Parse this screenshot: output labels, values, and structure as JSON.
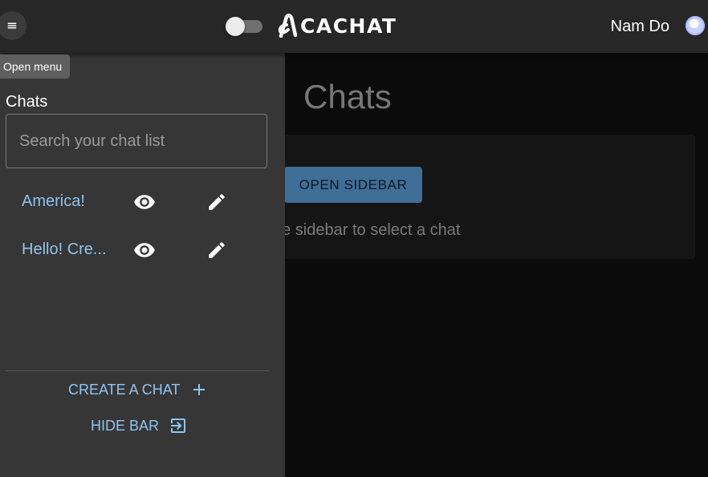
{
  "header": {
    "menu_icon": "hamburger-menu-icon",
    "tooltip": "Open menu",
    "theme_toggle_icon": "toggle-switch",
    "brand": "CACHAT",
    "user_name": "Nam Do",
    "avatar_icon": "user-avatar"
  },
  "sidebar": {
    "title": "Chats",
    "search_placeholder": "Search your chat list",
    "chats": [
      {
        "name": "America!",
        "view_icon": "eye-icon",
        "edit_icon": "pencil-icon"
      },
      {
        "name": "Hello! Cre...",
        "view_icon": "eye-icon",
        "edit_icon": "pencil-icon"
      }
    ],
    "create_label": "CREATE A CHAT",
    "create_icon": "plus-icon",
    "hide_label": "HIDE BAR",
    "hide_icon": "exit-to-app-icon"
  },
  "main": {
    "title": "Chats",
    "open_sidebar_label": "OPEN SIDEBAR",
    "hint": "he sidebar to select a chat"
  },
  "colors": {
    "accent": "#8fc4ef",
    "appbar": "#272727",
    "drawer": "#363636",
    "button": "#3f6e97"
  }
}
